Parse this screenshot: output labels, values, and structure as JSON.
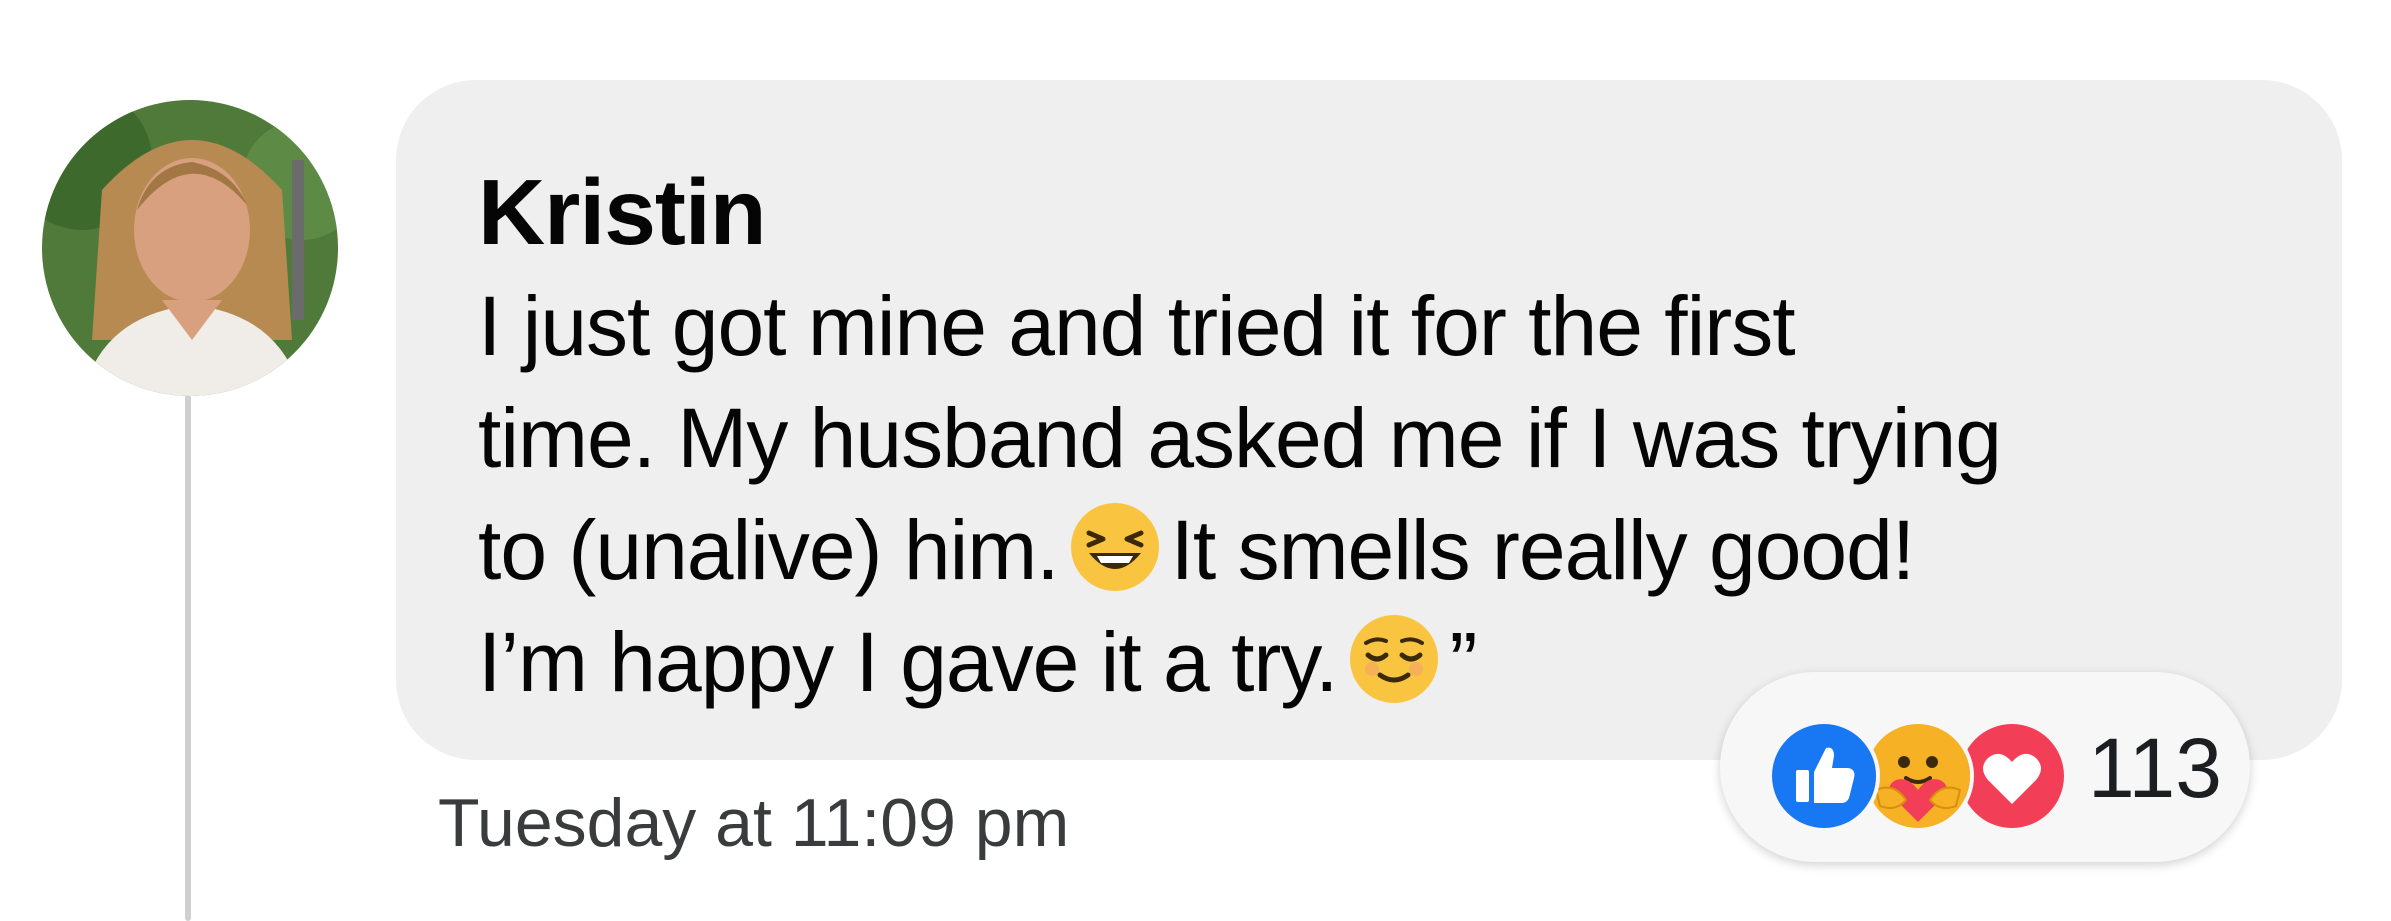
{
  "comment": {
    "author": "Kristin",
    "lines": [
      {
        "before": "I just got mine and tried it for the first",
        "emoji": "",
        "after": ""
      },
      {
        "before": "time. My husband asked me if I was trying",
        "emoji": "",
        "after": ""
      },
      {
        "before": "to (unalive) him.",
        "emoji": "laughing-squinting-face-emoji",
        "after": "It smells really good!"
      },
      {
        "before": "I’m happy I gave it a try.",
        "emoji": "relieved-face-emoji",
        "after": "”"
      }
    ],
    "timestamp": "Tuesday at 11:09 pm"
  },
  "reactions": {
    "icons": [
      "like-reaction-icon",
      "care-reaction-icon",
      "love-reaction-icon"
    ],
    "count": "113"
  },
  "colors": {
    "bubble": "#efefef",
    "like_blue": "#1877f2",
    "love_red": "#f33e58",
    "care_yellow": "#f7b125",
    "text": "#050505",
    "timestamp": "#3a3b3c"
  }
}
